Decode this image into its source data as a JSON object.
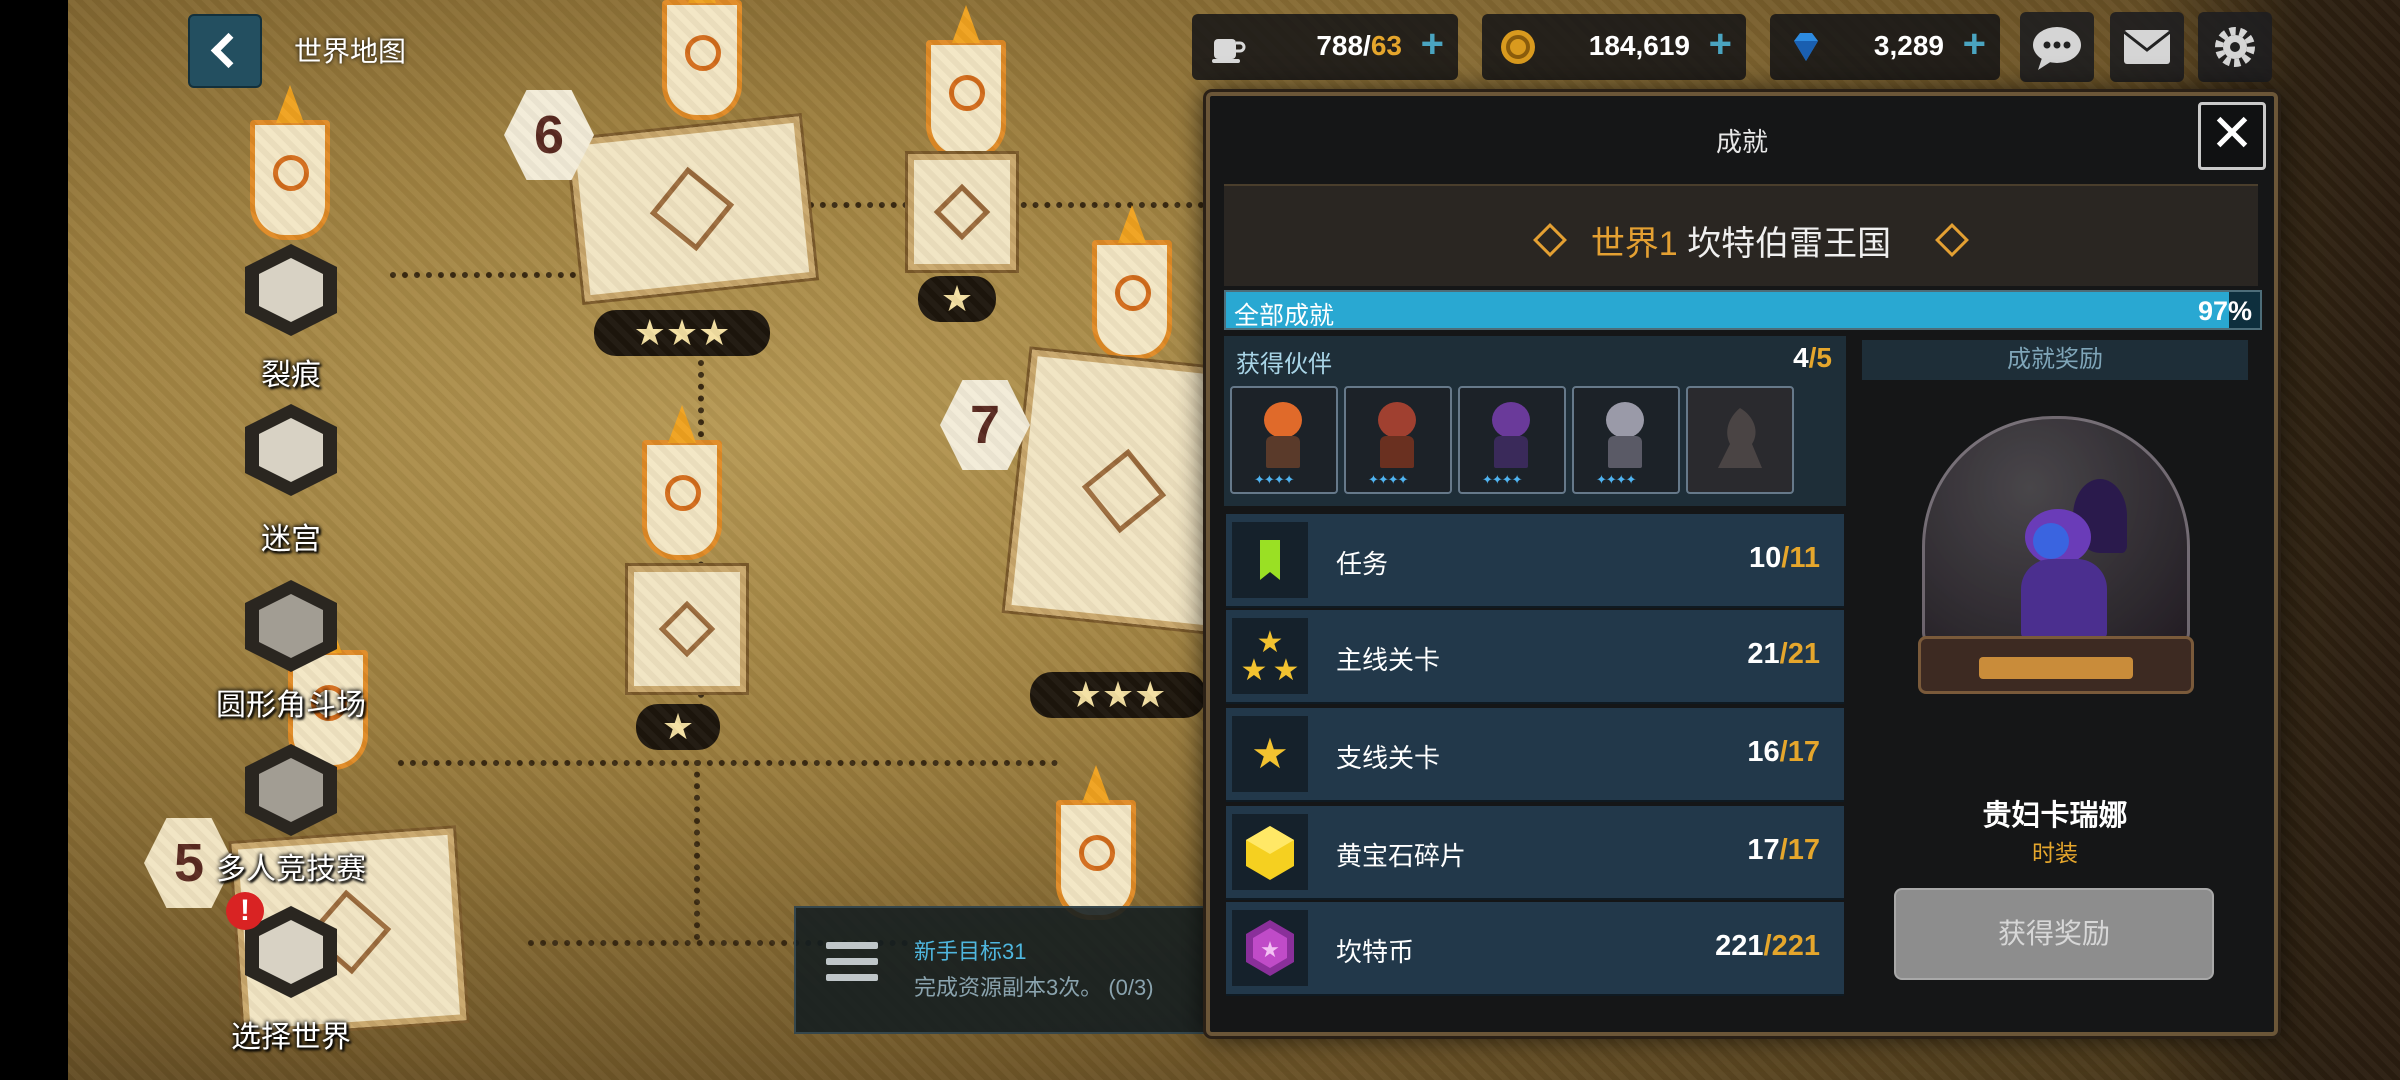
{
  "top_bar": {
    "title": "世界地图",
    "stamina": {
      "value": "788/",
      "max": "63",
      "icon": "coffee-cup-icon"
    },
    "gold": {
      "value": "184,619",
      "icon": "gold-coin-icon"
    },
    "gems": {
      "value": "3,289",
      "icon": "blue-gem-icon"
    },
    "plus": "+"
  },
  "map": {
    "stage_numbers": [
      "6",
      "7",
      "5"
    ],
    "star_three": "★★★",
    "star_one": "★",
    "side_menu": [
      {
        "label": "裂痕"
      },
      {
        "label": "迷宫"
      },
      {
        "label": "圆形角斗场"
      },
      {
        "label": "多人竞技赛"
      },
      {
        "label": "选择世界"
      }
    ],
    "alert_mark": "!"
  },
  "goal": {
    "title": "新手目标31",
    "desc": "完成资源副本3次。 (0/3)"
  },
  "panel": {
    "title": "成就",
    "close": "✕",
    "world_num": "世界1",
    "world_name": "坎特伯雷王国",
    "progress_label": "全部成就",
    "progress_pct": "97%",
    "progress_value": 0.97,
    "partners": {
      "title": "获得伙伴",
      "count": "4",
      "total": "/5",
      "stars": "✦✦✦✦",
      "colors": [
        "#e06a2a",
        "#a04030",
        "#6a3a9a",
        "#9a9aa8"
      ]
    },
    "rows": [
      {
        "label": "任务",
        "value": "10",
        "total": "/11",
        "icon": "bookmark-icon"
      },
      {
        "label": "主线关卡",
        "value": "21",
        "total": "/21",
        "icon": "three-stars-icon"
      },
      {
        "label": "支线关卡",
        "value": "16",
        "total": "/17",
        "icon": "star-icon"
      },
      {
        "label": "黄宝石碎片",
        "value": "17",
        "total": "/17",
        "icon": "yellow-gem-icon"
      },
      {
        "label": "坎特币",
        "value": "221",
        "total": "/221",
        "icon": "purple-coin-icon"
      }
    ],
    "reward": {
      "head": "成就奖励",
      "name": "贵妇卡瑞娜",
      "type": "时装",
      "button": "获得奖励"
    }
  }
}
